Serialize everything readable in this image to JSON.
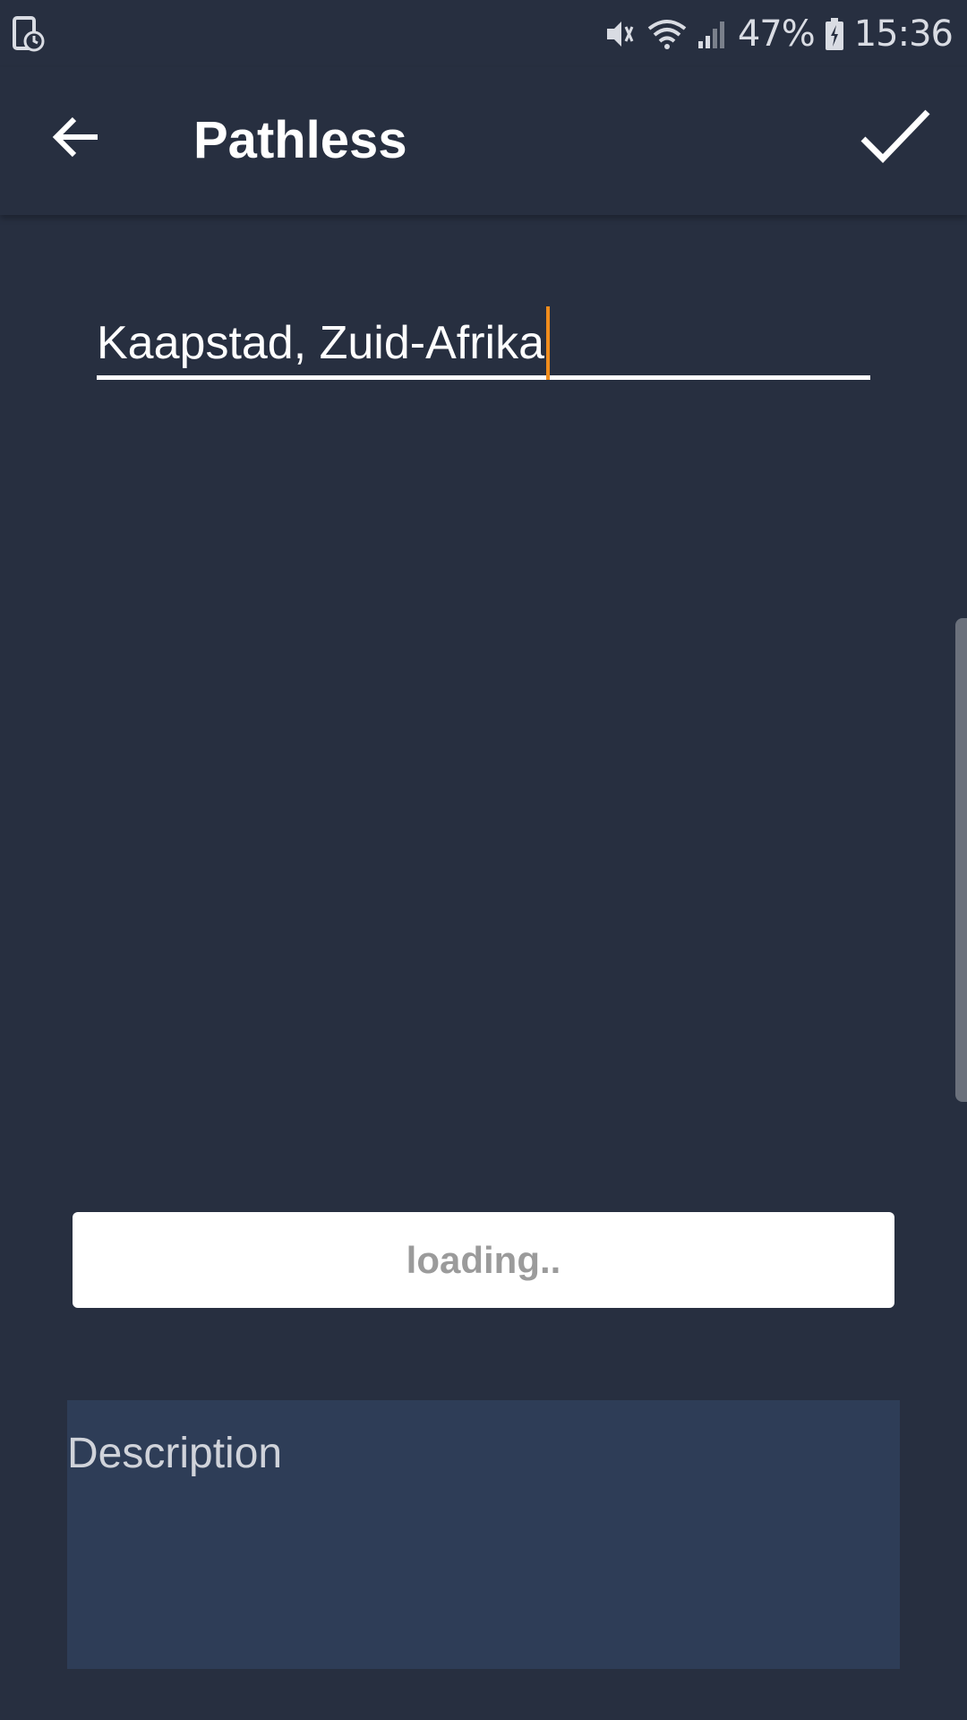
{
  "status_bar": {
    "battery": "47%",
    "time": "15:36"
  },
  "app_bar": {
    "title": "Pathless"
  },
  "location_input": {
    "value": "Kaapstad, Zuid-Afrika"
  },
  "loading_button": {
    "label": "loading.."
  },
  "description": {
    "placeholder": "Description"
  },
  "icons": {
    "back": "arrow-left-icon",
    "confirm": "checkmark-icon",
    "mute": "vibrate-mute-icon",
    "wifi": "wifi-icon",
    "signal": "signal-icon",
    "battery": "battery-charging-icon"
  },
  "colors": {
    "background": "#272f40",
    "cursor": "#f08c1c",
    "description_bg": "#2e3d57",
    "loading_text": "#9b9b9b"
  }
}
